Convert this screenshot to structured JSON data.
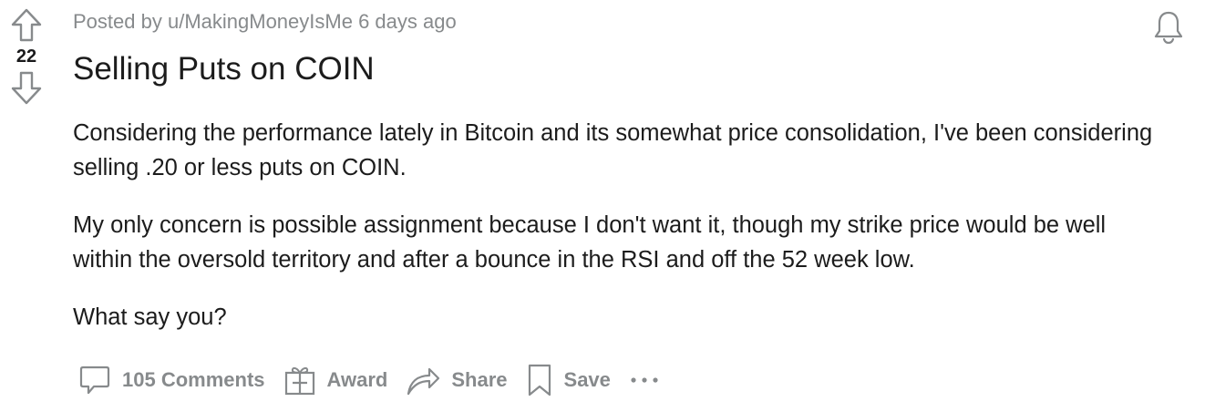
{
  "post": {
    "votes": "22",
    "meta_prefix": "Posted by",
    "author": "u/MakingMoneyIsMe",
    "age": "6 days ago",
    "title": "Selling Puts on COIN",
    "paragraphs": [
      "Considering the performance lately in Bitcoin and its somewhat price consolidation, I've been considering selling .20 or less puts on COIN.",
      "My only concern is possible assignment because I don't want it, though my strike price would be well within the oversold territory and after a bounce in the RSI and off the 52 week low.",
      "What say you?"
    ]
  },
  "actions": {
    "comments": "105 Comments",
    "award": "Award",
    "share": "Share",
    "save": "Save"
  },
  "icons": {
    "upvote": "arrow-up-icon",
    "downvote": "arrow-down-icon",
    "bell": "bell-icon",
    "comment": "comment-icon",
    "award": "gift-icon",
    "share": "share-icon",
    "save": "bookmark-icon",
    "more": "more-icon"
  },
  "colors": {
    "text": "#1c1c1c",
    "muted": "#878a8c"
  }
}
